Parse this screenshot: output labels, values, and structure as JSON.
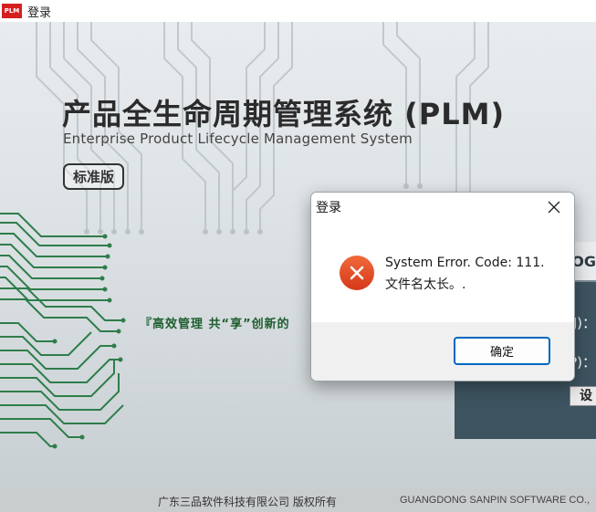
{
  "window": {
    "logo_text": "PLM",
    "title": "登录"
  },
  "splash": {
    "main_title": "产品全生命周期管理系统 (PLM)",
    "sub_title": "Enterprise Product Lifecycle Management System",
    "edition": "标准版",
    "slogan": "『高效管理  共“享”创新的",
    "colors": {
      "circuit": "#2e7d4a",
      "slogan": "#1e5e2e",
      "panel": "#3d5460"
    }
  },
  "login_panel": {
    "header_partial": "OG",
    "user_label_partial": "J)：",
    "password_label_partial": "P)：",
    "settings_button_partial": "设"
  },
  "footer": {
    "company_cn": "广东三品软件科技有限公司   版权所有",
    "company_en": "GUANGDONG SANPIN SOFTWARE CO.,"
  },
  "dialog": {
    "title": "登录",
    "close_icon": "close-icon",
    "error_icon": "error-icon",
    "message_line1": "System Error.  Code: 111.",
    "message_line2": "文件名太长。.",
    "ok_label": "确定",
    "colors": {
      "error": "#e2481d",
      "accent": "#0067c0"
    }
  }
}
